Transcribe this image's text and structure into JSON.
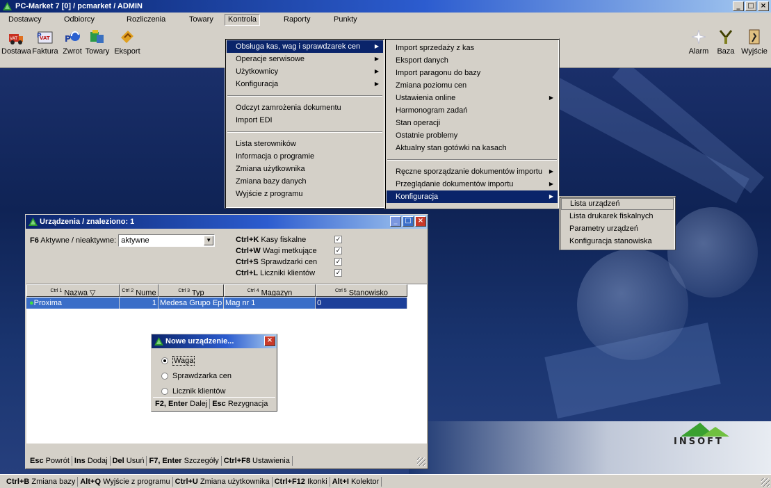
{
  "window": {
    "title": "PC-Market 7 [0] / pcmarket / ADMIN",
    "buttons": [
      "_",
      "□",
      "×"
    ]
  },
  "menu_bar": [
    {
      "label": "Dostawcy",
      "ul": "D"
    },
    {
      "label": "Odbiorcy",
      "ul": "O"
    },
    {
      "label": "Rozliczenia",
      "ul": "R"
    },
    {
      "label": "Towary",
      "ul": "T"
    },
    {
      "label": "Kontrola",
      "ul": "K"
    },
    {
      "label": "Raporty",
      "ul": "a"
    },
    {
      "label": "Punkty",
      "ul": "P"
    }
  ],
  "toolbar": {
    "left": [
      "Dostawa",
      "Faktura",
      "Zwrot",
      "Towary",
      "Eksport"
    ],
    "right": [
      "Alarm",
      "Baza",
      "Wyjście"
    ]
  },
  "kontrola_menu": [
    "Obsługa kas, wag i sprawdzarek cen",
    "Operacje serwisowe",
    "Użytkownicy",
    "Konfiguracja",
    "Odczyt zamrożenia dokumentu",
    "Import EDI",
    "Lista sterowników",
    "Informacja o programie",
    "Zmiana użytkownika",
    "Zmiana bazy danych",
    "Wyjście z programu"
  ],
  "obsluga_menu": [
    "Import sprzedaży z kas",
    "Eksport danych",
    "Import paragonu do bazy",
    "Zmiana poziomu cen",
    "Ustawienia online",
    "Harmonogram zadań",
    "Stan operacji",
    "Ostatnie problemy",
    "Aktualny stan gotówki na kasach",
    "Ręczne sporządzanie dokumentów importu",
    "Przeglądanie dokumentów importu",
    "Konfiguracja"
  ],
  "konfiguracja_menu": [
    "Lista urządzeń",
    "Lista drukarek fiskalnych",
    "Parametry urządzeń",
    "Konfiguracja stanowiska"
  ],
  "urzadzenia": {
    "title": "Urządzenia / znaleziono: 1",
    "filter_key": "F6",
    "filter_label": "Aktywne / nieaktywne:",
    "filter_value": "aktywne",
    "types": [
      {
        "key": "Ctrl+K",
        "label": "Kasy fiskalne",
        "checked": true
      },
      {
        "key": "Ctrl+W",
        "label": "Wagi metkujące",
        "checked": true
      },
      {
        "key": "Ctrl+S",
        "label": "Sprawdzarki cen",
        "checked": true
      },
      {
        "key": "Ctrl+L",
        "label": "Liczniki klientów",
        "checked": true
      }
    ],
    "columns": [
      {
        "key": "Ctrl 1",
        "label": "Nazwa"
      },
      {
        "key": "Ctrl 2",
        "label": "Nume"
      },
      {
        "key": "Ctrl 3",
        "label": "Typ"
      },
      {
        "key": "Ctrl 4",
        "label": "Magazyn"
      },
      {
        "key": "Ctrl 5",
        "label": "Stanowisko"
      }
    ],
    "rows": [
      {
        "nazwa": "Proxima",
        "numer": "1",
        "typ": "Medesa Grupo Ep",
        "magazyn": "Mag nr 1",
        "stanowisko": "0"
      }
    ],
    "status": [
      {
        "key": "Esc",
        "label": "Powrót"
      },
      {
        "key": "Ins",
        "label": "Dodaj"
      },
      {
        "key": "Del",
        "label": "Usuń"
      },
      {
        "key": "F7, Enter",
        "label": "Szczegóły"
      },
      {
        "key": "Ctrl+F8",
        "label": "Ustawienia"
      }
    ]
  },
  "nowe_dialog": {
    "title": "Nowe urządzenie...",
    "options": [
      "Waga",
      "Sprawdzarka cen",
      "Licznik klientów"
    ],
    "selected": 0,
    "buttons": [
      {
        "key": "F2, Enter",
        "label": "Dalej"
      },
      {
        "key": "Esc",
        "label": "Rezygnacja"
      }
    ]
  },
  "status_bar": [
    {
      "key": "Ctrl+B",
      "label": "Zmiana bazy"
    },
    {
      "key": "Alt+Q",
      "label": "Wyjście z programu"
    },
    {
      "key": "Ctrl+U",
      "label": "Zmiana użytkownika"
    },
    {
      "key": "Ctrl+F12",
      "label": "Ikonki"
    },
    {
      "key": "Alt+I",
      "label": "Kolektor"
    }
  ],
  "logo_text": "INSOFT"
}
